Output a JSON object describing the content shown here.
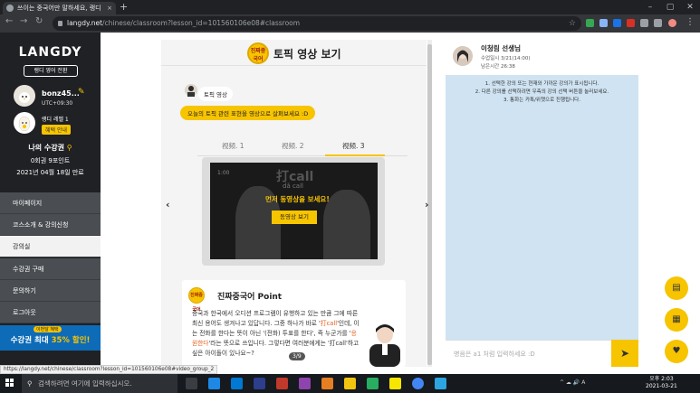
{
  "browser": {
    "tab_title": "쓰이는 중국어만 말하세요, 랭디",
    "tab_close": "×",
    "new_tab": "+",
    "url_host": "langdy.net",
    "url_path": "/chinese/classroom?lesson_id=101560106e08#classroom",
    "win_min": "–",
    "win_max": "▢",
    "win_close": "✕",
    "back": "←",
    "forward": "→",
    "reload": "↻",
    "star": "☆"
  },
  "sidebar": {
    "logo": "LANGDY",
    "switch_button": "랭디 영어 전환",
    "username": "bonz45...",
    "timezone": "UTC+09:30",
    "level": "랭디 레벨 1",
    "benefit": "혜택 안내",
    "pass_title": "나의 수강권",
    "pass_count": "0회권 9포인트",
    "pass_date": "2021년 04월 18일 만료",
    "menu": [
      {
        "label": "마이페이지"
      },
      {
        "label": "코스소개 & 강의신청"
      },
      {
        "label": "강의실"
      },
      {
        "label": "수강권 구매"
      },
      {
        "label": "문의하기"
      },
      {
        "label": "로그아웃"
      }
    ],
    "promo_tag": "이번달 혜택",
    "promo_main_prefix": "수강권 최대 ",
    "promo_main_highlight": "35% 할인!",
    "collapse_icon": "‹"
  },
  "main": {
    "badge_text": "진짜중국어",
    "title": "토픽 영상 보기",
    "tutor_label": "토픽 영상",
    "tutor_message": "오늘의 토픽 관련 표현을 영상으로 살펴보세요 :D",
    "video_tabs": [
      {
        "label": "视频. 1"
      },
      {
        "label": "视频. 2"
      },
      {
        "label": "视频. 3"
      }
    ],
    "video": {
      "time": "1:00",
      "big_text": "打call",
      "sub_text": "dǎ call",
      "play_hint": "먼저 동영상을 보세요!",
      "play_button": "동영상 보기"
    },
    "prev_arrow": "‹",
    "next_arrow": "›",
    "point": {
      "badge_text": "진짜중국어",
      "title": "진짜중국어 Point",
      "body_1": "중국과 한국에서 오디션 프로그램이 유행하고 있는 만큼 그에 따른 최신 용어도 생겨나고 있답니다. 그중 하나가 바로 '",
      "kw_1": "打call",
      "body_2": "'인데, 이는 전화를 한다는 뜻이 아닌 '(전화) 투표를 한다', 즉 누군가를 '",
      "kw_2": "응원한다",
      "body_3": "'라는 뜻으로 쓰입니다. 그렇다면 여러분에게는 '打call'하고 싶은 아이돌이 있나요~?",
      "page": "3/9"
    }
  },
  "chat": {
    "teacher_name": "이청림 선생님",
    "lesson_time": "수업일시 3/21(14:00)",
    "remaining": "남은시간 26:38",
    "notice_1": "1. 선택한 강의 또는 현재와 가까운 강의가 표시됩니다.",
    "notice_2": "2. 다른 강의를 선택하려면 우측의 강의 선택 버튼을 눌러보세요.",
    "notice_3": "3. 통화는 카톡/위챗으로 진행됩니다.",
    "input_placeholder": "병음은 a1 처럼 입력하세요 :D",
    "send_icon": "➤"
  },
  "fabs": [
    {
      "icon": "▤"
    },
    {
      "icon": "▦"
    },
    {
      "icon": "♥"
    }
  ],
  "status_url": "https://langdy.net/chinese/classroom?lesson_id=101560106e08#video_group_2",
  "taskbar": {
    "search_placeholder": "검색하려면 여기에 입력하십시오.",
    "time": "오후 2:03",
    "date": "2021-03-21",
    "tray": "^ ☁ 🔊 A"
  },
  "colors": {
    "accent": "#f7c400",
    "sidebar_bg": "#1f2124",
    "chat_bg": "#cfe3f2",
    "promo_bg": "#0d6bb8"
  }
}
